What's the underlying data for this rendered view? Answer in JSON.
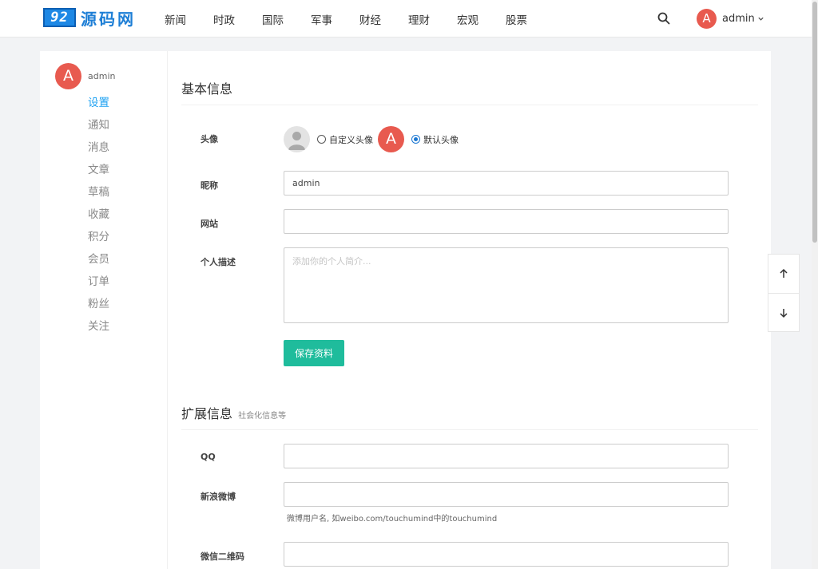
{
  "header": {
    "logo_badge": "92",
    "logo_text": "源码网",
    "nav": [
      "新闻",
      "时政",
      "国际",
      "军事",
      "财经",
      "理财",
      "宏观",
      "股票"
    ],
    "user_initial": "A",
    "user_name": "admin"
  },
  "sidebar": {
    "user_initial": "A",
    "user_name": "admin",
    "items": [
      "设置",
      "通知",
      "消息",
      "文章",
      "草稿",
      "收藏",
      "积分",
      "会员",
      "订单",
      "粉丝",
      "关注"
    ],
    "active_index": 0
  },
  "basic": {
    "title": "基本信息",
    "avatar_label": "头像",
    "custom_avatar": "自定义头像",
    "default_avatar": "默认头像",
    "default_avatar_initial": "A",
    "selected_avatar": "default",
    "nickname_label": "昵称",
    "nickname_value": "admin",
    "website_label": "网站",
    "website_value": "",
    "bio_label": "个人描述",
    "bio_placeholder": "添加你的个人简介...",
    "save_label": "保存资料"
  },
  "extended": {
    "title": "扩展信息",
    "subtitle": "社会化信息等",
    "qq_label": "QQ",
    "qq_value": "",
    "weibo_label": "新浪微博",
    "weibo_value": "",
    "weibo_hint": "微博用户名, 如weibo.com/touchumind中的touchumind",
    "wechat_label": "微信二维码",
    "wechat_value": ""
  },
  "colors": {
    "accent": "#1da1f2",
    "avatar": "#e85a4f",
    "save_button": "#1fbc9c"
  }
}
